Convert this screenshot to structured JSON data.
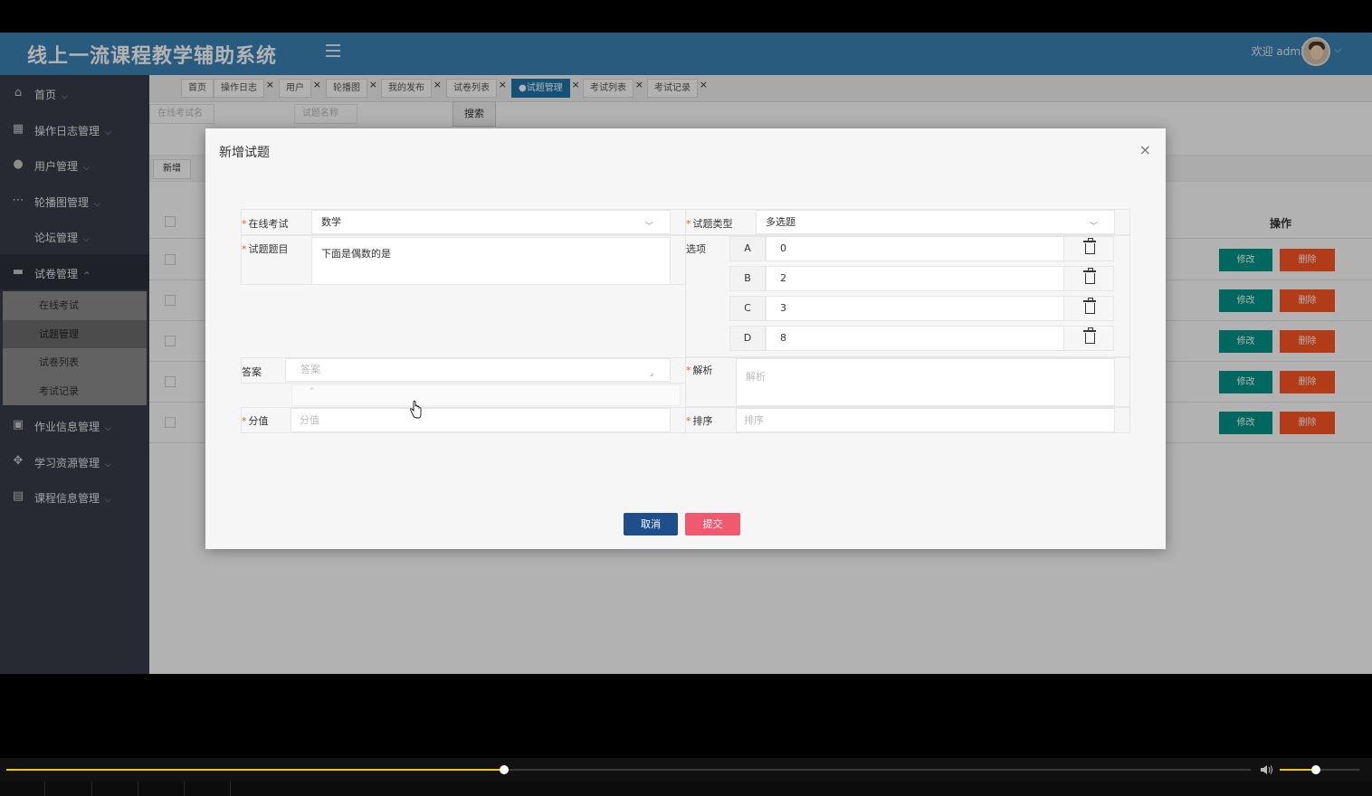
{
  "header": {
    "app_title": "线上一流课程教学辅助系统",
    "welcome": "欢迎 admin"
  },
  "sidebar": {
    "items": [
      {
        "label": "首页",
        "icon": "home-icon"
      },
      {
        "label": "操作日志管理",
        "icon": "grid-icon"
      },
      {
        "label": "用户管理",
        "icon": "user-icon"
      },
      {
        "label": "轮播图管理",
        "icon": "ellipsis-icon"
      },
      {
        "label": "论坛管理",
        "icon": ""
      },
      {
        "label": "试卷管理",
        "icon": "layout-icon"
      },
      {
        "label": "作业信息管理",
        "icon": "image-icon"
      },
      {
        "label": "学习资源管理",
        "icon": "apps-icon"
      },
      {
        "label": "课程信息管理",
        "icon": "table-icon"
      }
    ],
    "submenu": [
      "在线考试",
      "试题管理",
      "试卷列表",
      "考试记录"
    ]
  },
  "tabs": [
    "首页",
    "操作日志",
    "用户",
    "轮播图",
    "我的发布",
    "试卷列表",
    "●试题管理",
    "考试列表",
    "考试记录"
  ],
  "filters": {
    "exam_name_placeholder": "在线考试名",
    "question_name_placeholder": "试题名称",
    "search_label": "搜索"
  },
  "table": {
    "add_label": "新增",
    "op_header": "操作",
    "edit_label": "修改",
    "delete_label": "删除",
    "row_count": 5
  },
  "modal": {
    "title": "新增试题",
    "close": "×",
    "fields": {
      "exam_label": "在线考试",
      "exam_value": "数学",
      "type_label": "试题类型",
      "type_value": "多选题",
      "question_label": "试题题目",
      "question_value": "下面是偶数的是",
      "options_label": "选项",
      "answer_label": "答案",
      "answer_placeholder": "答案",
      "analysis_label": "解析",
      "analysis_placeholder": "解析",
      "score_label": "分值",
      "score_placeholder": "分值",
      "sort_label": "排序",
      "sort_placeholder": "排序"
    },
    "options": [
      {
        "key": "A",
        "value": "0"
      },
      {
        "key": "B",
        "value": "2"
      },
      {
        "key": "C",
        "value": "3"
      },
      {
        "key": "D",
        "value": "8"
      }
    ],
    "cancel_label": "取消",
    "submit_label": "提交"
  },
  "player": {
    "progress": 0.4,
    "volume": 0.45,
    "accent": "#f5c400"
  },
  "colors": {
    "header": "#3b83b6",
    "sidebar": "#393d49",
    "edit": "#009688",
    "delete": "#ff5722",
    "cancel": "#1e4e8c",
    "submit": "#f15a6e"
  }
}
